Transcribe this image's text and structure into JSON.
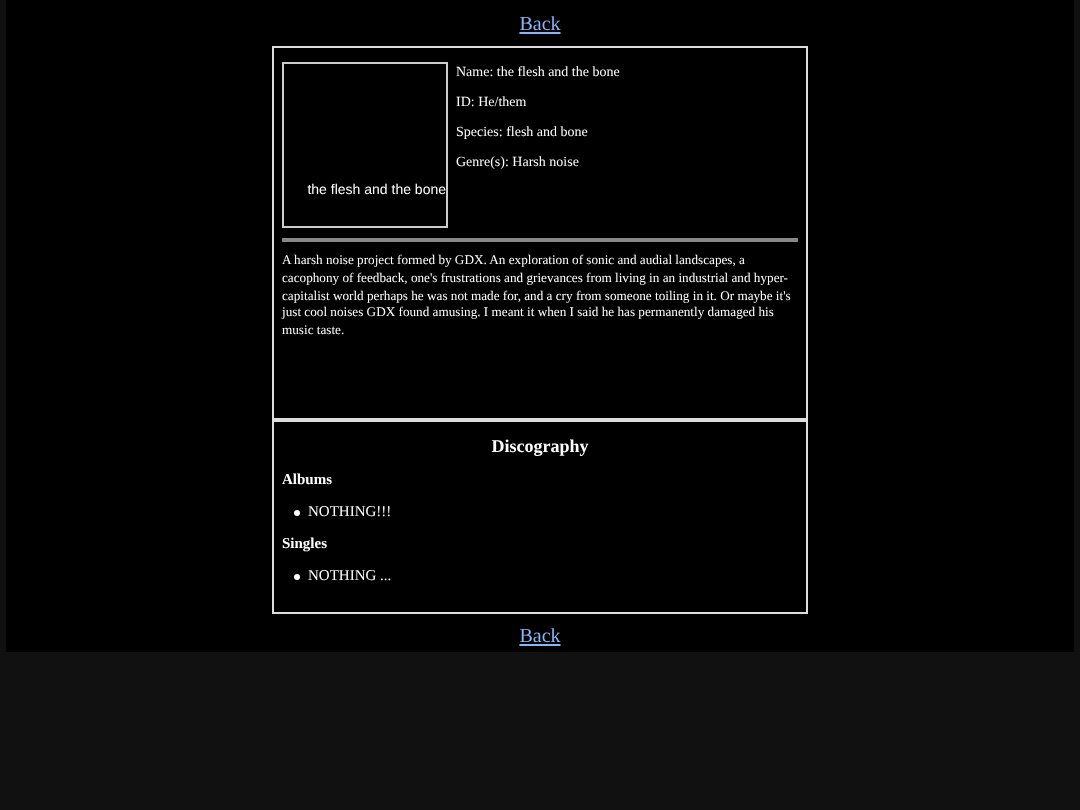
{
  "top_link": "Back",
  "profile": {
    "image_alt": "the flesh and the bone",
    "fields": [
      "Name: the flesh and the bone",
      "ID: He/them",
      "Species: flesh and bone",
      "Genre(s): Harsh noise"
    ],
    "description": "A harsh noise project formed by GDX. An exploration of sonic and audial landscapes, a cacophony of feedback, one's frustrations and grievances from living in an industrial and hyper-capitalist world perhaps he was not made for, and a cry from someone toiling in it. Or maybe it's just cool noises GDX found amusing. I meant it when I said he has permanently damaged his music taste."
  },
  "discography": {
    "title": "Discography",
    "sections": [
      {
        "heading": "Albums",
        "items": [
          "NOTHING!!!"
        ]
      },
      {
        "heading": "Singles",
        "items": [
          "NOTHING ..."
        ]
      }
    ]
  },
  "bottom_link": "Back"
}
